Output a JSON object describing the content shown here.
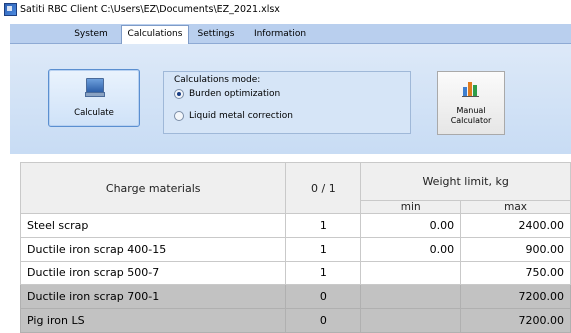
{
  "window": {
    "title": "Satiti RBC Client C:\\Users\\EZ\\Documents\\EZ_2021.xlsx"
  },
  "ribbon": {
    "tabs": [
      {
        "label": "System",
        "active": false
      },
      {
        "label": "Calculations",
        "active": true
      },
      {
        "label": "Settings",
        "active": false
      },
      {
        "label": "Information",
        "active": false
      }
    ],
    "calculate_label": "Calculate",
    "mode": {
      "title": "Calculations mode:",
      "options": [
        {
          "label": "Burden optimization",
          "selected": true
        },
        {
          "label": "Liquid metal correction",
          "selected": false
        }
      ]
    },
    "manual_calculator_label_line1": "Manual",
    "manual_calculator_label_line2": "Calculator"
  },
  "grid": {
    "headers": {
      "materials": "Charge materials",
      "toggle": "0 / 1",
      "weight_limit": "Weight limit, kg",
      "min": "min",
      "max": "max"
    },
    "rows": [
      {
        "name": "Steel scrap",
        "flag": "1",
        "min": "0.00",
        "max": "2400.00",
        "disabled": false
      },
      {
        "name": "Ductile iron scrap 400-15",
        "flag": "1",
        "min": "0.00",
        "max": "900.00",
        "disabled": false
      },
      {
        "name": "Ductile iron scrap 500-7",
        "flag": "1",
        "min": "",
        "max": "750.00",
        "disabled": false
      },
      {
        "name": "Ductile iron scrap 700-1",
        "flag": "0",
        "min": "",
        "max": "7200.00",
        "disabled": true
      },
      {
        "name": "Pig iron LS",
        "flag": "0",
        "min": "",
        "max": "7200.00",
        "disabled": true
      }
    ]
  }
}
